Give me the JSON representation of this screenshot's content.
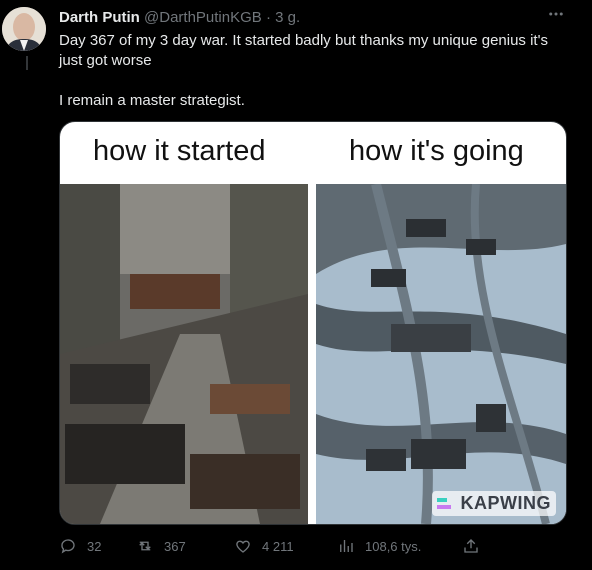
{
  "tweet": {
    "author_name": "Darth Putin",
    "author_handle": "@DarthPutinKGB",
    "separator": "·",
    "time": "3 g.",
    "text_line1": "Day 367 of my 3 day war. It started badly but thanks my unique genius it's just got worse",
    "text_line2": "I remain a master strategist."
  },
  "media": {
    "caption_left": "how it started",
    "caption_right": "how it's going",
    "watermark": "KAPWING"
  },
  "actions": {
    "replies": "32",
    "retweets": "367",
    "likes": "4 211",
    "views": "108,6 tys."
  },
  "icons": [
    "more-icon",
    "reply-icon",
    "retweet-icon",
    "like-icon",
    "views-icon",
    "share-icon"
  ],
  "colors": {
    "background": "#000000",
    "text": "#e7e9ea",
    "muted": "#71767b"
  }
}
